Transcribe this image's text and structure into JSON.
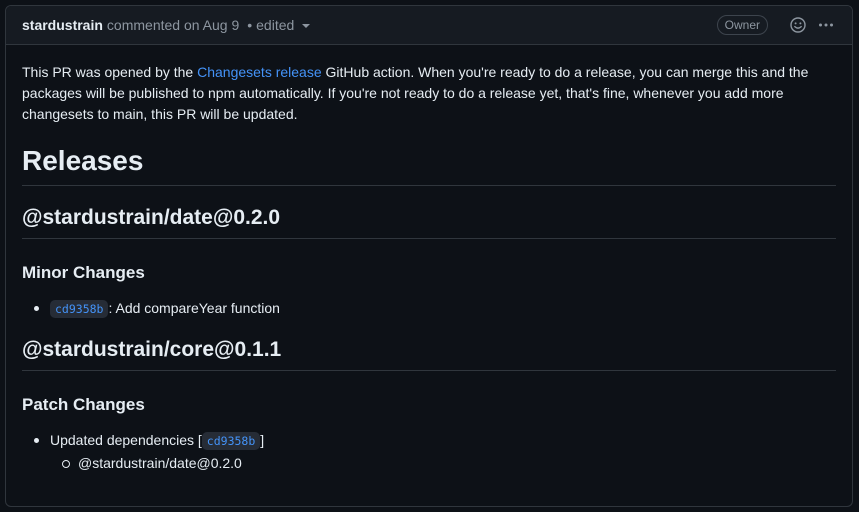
{
  "header": {
    "author": "stardustrain",
    "commented_text": "commented on Aug 9",
    "separator": "•",
    "edited_text": "edited",
    "owner_badge": "Owner"
  },
  "body": {
    "intro": {
      "before_link": "This PR was opened by the ",
      "link_text": "Changesets release",
      "after_link": " GitHub action. When you're ready to do a release, you can merge this and the packages will be published to npm automatically. If you're not ready to do a release yet, that's fine, whenever you add more changesets to main, this PR will be updated."
    },
    "releases_heading": "Releases",
    "packages": [
      {
        "name": "@stardustrain/date@0.2.0",
        "section": "Minor Changes",
        "items": [
          {
            "sha": "cd9358b",
            "text": ": Add compareYear function"
          }
        ]
      },
      {
        "name": "@stardustrain/core@0.1.1",
        "section": "Patch Changes",
        "items": [
          {
            "text_before": "Updated dependencies [",
            "sha": "cd9358b",
            "text_after": "]",
            "sub_items": [
              "@stardustrain/date@0.2.0"
            ]
          }
        ]
      }
    ]
  },
  "icons": {
    "reaction": "smiley-icon",
    "more": "kebab-horizontal-icon",
    "edited_dropdown": "triangle-down-icon"
  },
  "colors": {
    "background": "#0d1117",
    "header_bg": "#161b22",
    "border": "#30363d",
    "text": "#e6edf3",
    "muted": "#8d96a0",
    "link": "#4493f8"
  }
}
